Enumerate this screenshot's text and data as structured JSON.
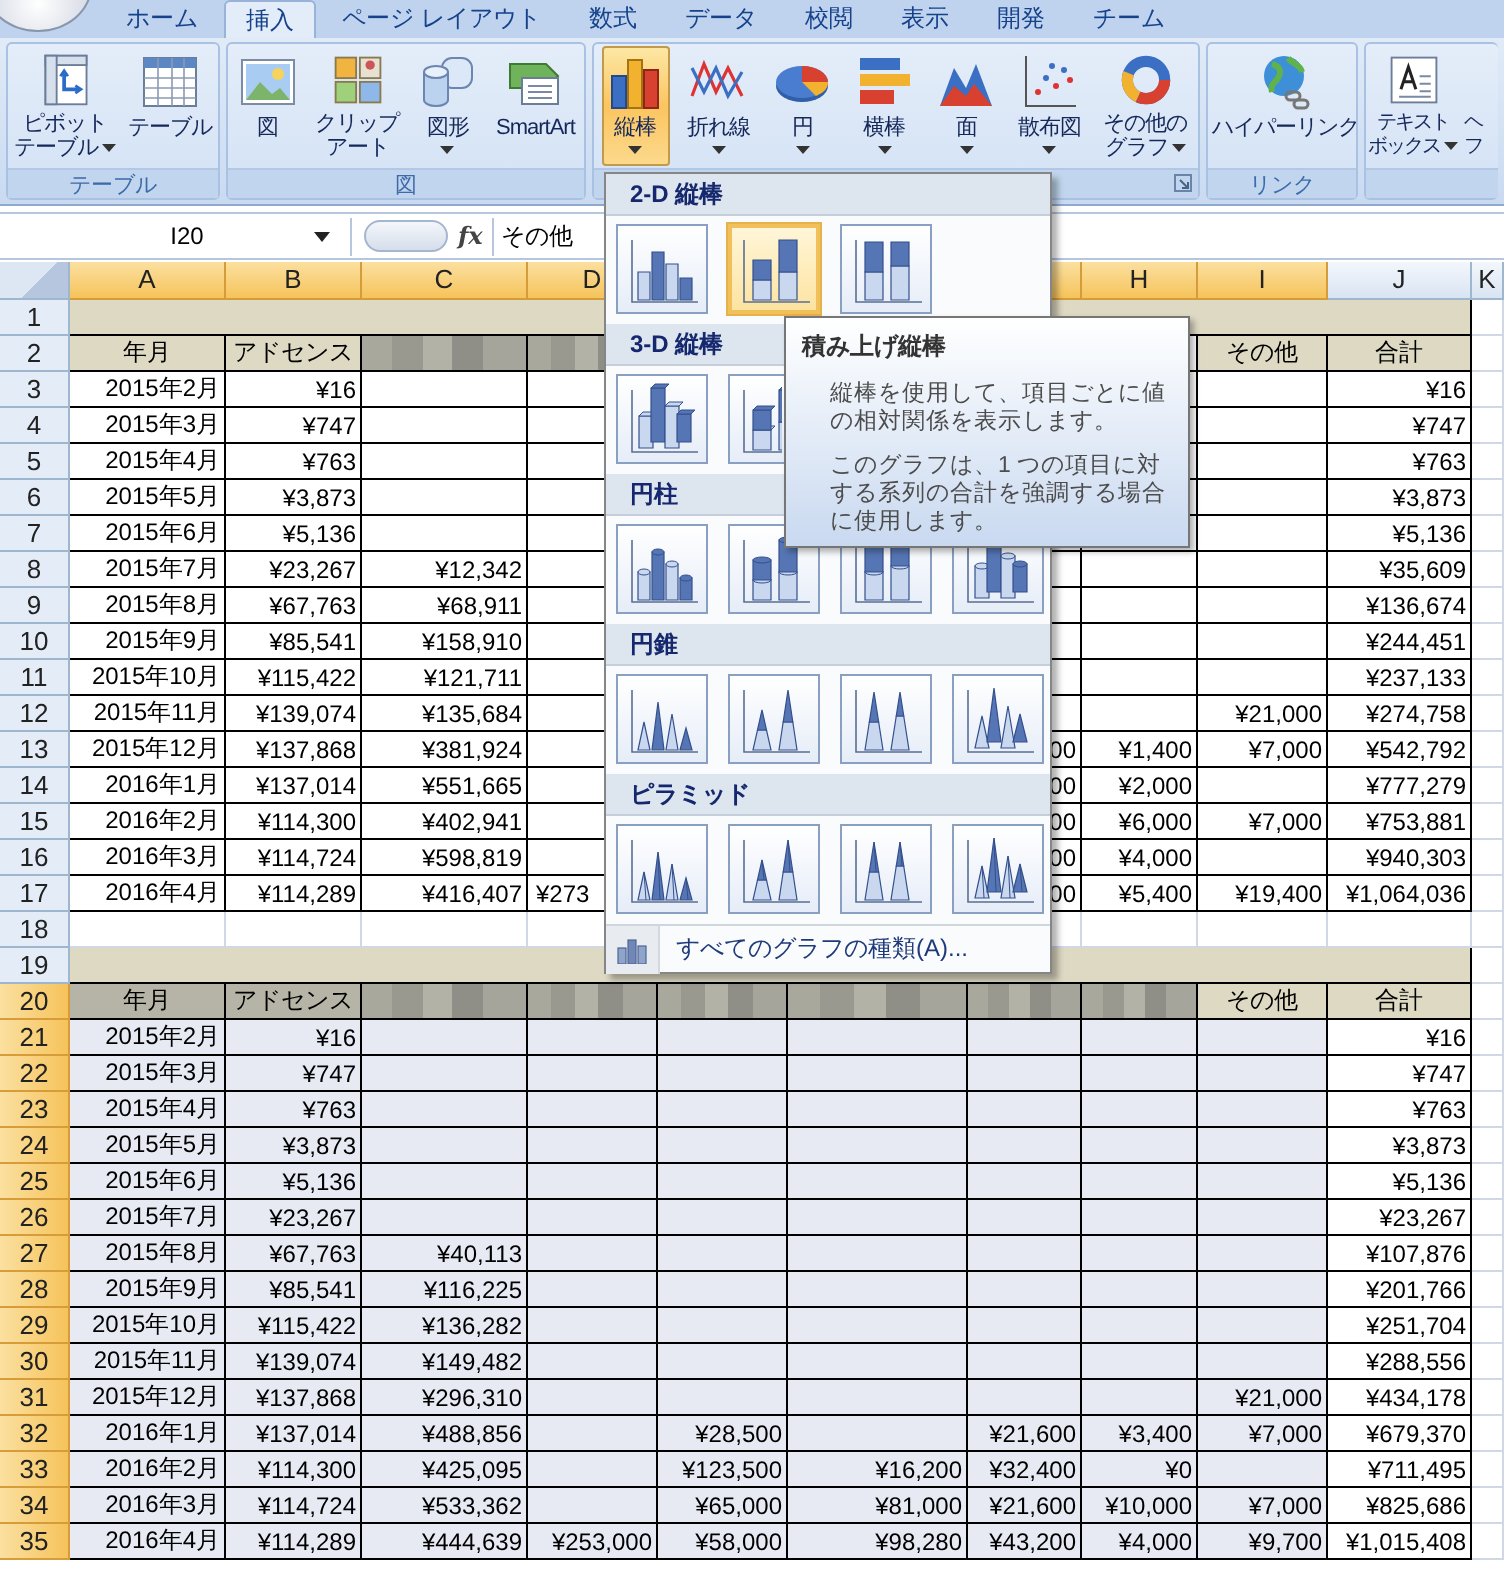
{
  "tabs": [
    {
      "label": "ホーム",
      "selected": false
    },
    {
      "label": "挿入",
      "selected": true
    },
    {
      "label": "ページ レイアウト",
      "selected": false
    },
    {
      "label": "数式",
      "selected": false
    },
    {
      "label": "データ",
      "selected": false
    },
    {
      "label": "校閲",
      "selected": false
    },
    {
      "label": "表示",
      "selected": false
    },
    {
      "label": "開発",
      "selected": false
    },
    {
      "label": "チーム",
      "selected": false
    }
  ],
  "ribbon": {
    "groups": [
      {
        "label": "テーブル",
        "launcher": false,
        "buttons": [
          {
            "lines": [
              "ピボット",
              "テーブル"
            ],
            "dropdown": true,
            "selected": false
          },
          {
            "lines": [
              "テーブル"
            ],
            "dropdown": false,
            "selected": false
          }
        ]
      },
      {
        "label": "図",
        "launcher": false,
        "buttons": [
          {
            "lines": [
              "図"
            ],
            "dropdown": false,
            "selected": false
          },
          {
            "lines": [
              "クリップ",
              "アート"
            ],
            "dropdown": false,
            "selected": false
          },
          {
            "lines": [
              "図形"
            ],
            "dropdown": true,
            "selected": false
          },
          {
            "lines": [
              "SmartArt"
            ],
            "dropdown": false,
            "selected": false
          }
        ]
      },
      {
        "launcher": true,
        "buttons": [
          {
            "lines": [
              "縦棒"
            ],
            "dropdown": true,
            "selected": true
          },
          {
            "lines": [
              "折れ線"
            ],
            "dropdown": true,
            "selected": false
          },
          {
            "lines": [
              "円"
            ],
            "dropdown": true,
            "selected": false
          },
          {
            "lines": [
              "横棒"
            ],
            "dropdown": true,
            "selected": false
          },
          {
            "lines": [
              "面"
            ],
            "dropdown": true,
            "selected": false
          },
          {
            "lines": [
              "散布図"
            ],
            "dropdown": true,
            "selected": false
          },
          {
            "lines": [
              "その他の",
              "グラフ"
            ],
            "dropdown": true,
            "selected": false
          }
        ]
      },
      {
        "label": "リンク",
        "launcher": false,
        "buttons": [
          {
            "lines": [
              "ハイパーリンク"
            ],
            "dropdown": false,
            "selected": false
          }
        ]
      },
      {
        "launcher": false,
        "buttons": [
          {
            "lines": [
              "テキスト",
              "ボックス"
            ],
            "dropdown": true,
            "selected": false
          },
          {
            "lines": [
              "ヘ",
              "フ"
            ],
            "dropdown": false,
            "selected": false
          }
        ]
      }
    ]
  },
  "formula_bar": {
    "name_box": "I20",
    "function_label": "fx",
    "value": "その他"
  },
  "grid": {
    "columns": [
      {
        "label": "A",
        "selected": true
      },
      {
        "label": "B",
        "selected": true
      },
      {
        "label": "C",
        "selected": true
      },
      {
        "label": "D",
        "selected": true
      },
      {
        "selected": true
      },
      {
        "selected": true
      },
      {
        "selected": true
      },
      {
        "label": "H",
        "selected": true
      },
      {
        "label": "I",
        "selected": true
      },
      {
        "label": "J",
        "selected": false
      },
      {
        "label": "K",
        "selected": false
      }
    ],
    "rows": [
      {
        "number": "1",
        "selected": false,
        "kind": "band"
      },
      {
        "number": "2",
        "selected": false,
        "kind": "header",
        "cells": {
          "A": "年月",
          "B": "アドセンス",
          "C": {
            "blurred": true
          },
          "D": {
            "blurred": true
          },
          "I": "その他",
          "J": "合計"
        }
      },
      {
        "number": "3",
        "selected": false,
        "kind": "data",
        "cells": {
          "A": "2015年2月",
          "B": "¥16",
          "J": "¥16"
        }
      },
      {
        "number": "4",
        "selected": false,
        "kind": "data",
        "cells": {
          "A": "2015年3月",
          "B": "¥747",
          "J": "¥747"
        }
      },
      {
        "number": "5",
        "selected": false,
        "kind": "data",
        "cells": {
          "A": "2015年4月",
          "B": "¥763",
          "J": "¥763"
        }
      },
      {
        "number": "6",
        "selected": false,
        "kind": "data",
        "cells": {
          "A": "2015年5月",
          "B": "¥3,873",
          "J": "¥3,873"
        }
      },
      {
        "number": "7",
        "selected": false,
        "kind": "data",
        "cells": {
          "A": "2015年6月",
          "B": "¥5,136",
          "J": "¥5,136"
        }
      },
      {
        "number": "8",
        "selected": false,
        "kind": "data",
        "cells": {
          "A": "2015年7月",
          "B": "¥23,267",
          "C": "¥12,342",
          "J": "¥35,609"
        }
      },
      {
        "number": "9",
        "selected": false,
        "kind": "data",
        "cells": {
          "A": "2015年8月",
          "B": "¥67,763",
          "C": "¥68,911",
          "J": "¥136,674"
        }
      },
      {
        "number": "10",
        "selected": false,
        "kind": "data",
        "cells": {
          "A": "2015年9月",
          "B": "¥85,541",
          "C": "¥158,910",
          "J": "¥244,451"
        }
      },
      {
        "number": "11",
        "selected": false,
        "kind": "data",
        "cells": {
          "A": "2015年10月",
          "B": "¥115,422",
          "C": "¥121,711",
          "J": "¥237,133"
        }
      },
      {
        "number": "12",
        "selected": false,
        "kind": "data",
        "cells": {
          "A": "2015年11月",
          "B": "¥139,074",
          "C": "¥135,684",
          "I": "¥21,000",
          "J": "¥274,758"
        }
      },
      {
        "number": "13",
        "selected": false,
        "kind": "data",
        "cells": {
          "A": "2015年12月",
          "B": "¥137,868",
          "C": "¥381,924",
          "G": "00",
          "H": "¥1,400",
          "I": "¥7,000",
          "J": "¥542,792"
        }
      },
      {
        "number": "14",
        "selected": false,
        "kind": "data",
        "cells": {
          "A": "2016年1月",
          "B": "¥137,014",
          "C": "¥551,665",
          "G": "00",
          "H": "¥2,000",
          "J": "¥777,279"
        }
      },
      {
        "number": "15",
        "selected": false,
        "kind": "data",
        "cells": {
          "A": "2016年2月",
          "B": "¥114,300",
          "C": "¥402,941",
          "G": "00",
          "H": "¥6,000",
          "I": "¥7,000",
          "J": "¥753,881"
        }
      },
      {
        "number": "16",
        "selected": false,
        "kind": "data",
        "cells": {
          "A": "2016年3月",
          "B": "¥114,724",
          "C": "¥598,819",
          "G": "00",
          "H": "¥4,000",
          "J": "¥940,303"
        }
      },
      {
        "number": "17",
        "selected": false,
        "kind": "data",
        "cells": {
          "A": "2016年4月",
          "B": "¥114,289",
          "C": "¥416,407",
          "D": {
            "text": "¥273",
            "cut": true
          },
          "G": "00",
          "H": "¥5,400",
          "I": "¥19,400",
          "J": "¥1,064,036"
        }
      },
      {
        "number": "18",
        "selected": false,
        "kind": "blank"
      },
      {
        "number": "19",
        "selected": false,
        "kind": "band"
      },
      {
        "number": "20",
        "selected": true,
        "kind": "header",
        "cells": {
          "A": "年月",
          "B": "アドセンス",
          "C": {
            "blurred": true
          },
          "D": {
            "blurred": true
          },
          "E": {
            "blurred": true
          },
          "F": {
            "blurred": true
          },
          "G": {
            "blurred": true
          },
          "H": {
            "blurred": true
          },
          "I": {
            "text": "その他",
            "active": true
          },
          "J": "合計"
        }
      },
      {
        "number": "21",
        "selected": true,
        "kind": "data",
        "cells": {
          "A": "2015年2月",
          "B": "¥16",
          "J": "¥16"
        }
      },
      {
        "number": "22",
        "selected": true,
        "kind": "data",
        "cells": {
          "A": "2015年3月",
          "B": "¥747",
          "J": "¥747"
        }
      },
      {
        "number": "23",
        "selected": true,
        "kind": "data",
        "cells": {
          "A": "2015年4月",
          "B": "¥763",
          "J": "¥763"
        }
      },
      {
        "number": "24",
        "selected": true,
        "kind": "data",
        "cells": {
          "A": "2015年5月",
          "B": "¥3,873",
          "J": "¥3,873"
        }
      },
      {
        "number": "25",
        "selected": true,
        "kind": "data",
        "cells": {
          "A": "2015年6月",
          "B": "¥5,136",
          "J": "¥5,136"
        }
      },
      {
        "number": "26",
        "selected": true,
        "kind": "data",
        "cells": {
          "A": "2015年7月",
          "B": "¥23,267",
          "J": "¥23,267"
        }
      },
      {
        "number": "27",
        "selected": true,
        "kind": "data",
        "cells": {
          "A": "2015年8月",
          "B": "¥67,763",
          "C": "¥40,113",
          "J": "¥107,876"
        }
      },
      {
        "number": "28",
        "selected": true,
        "kind": "data",
        "cells": {
          "A": "2015年9月",
          "B": "¥85,541",
          "C": "¥116,225",
          "J": "¥201,766"
        }
      },
      {
        "number": "29",
        "selected": true,
        "kind": "data",
        "cells": {
          "A": "2015年10月",
          "B": "¥115,422",
          "C": "¥136,282",
          "J": "¥251,704"
        }
      },
      {
        "number": "30",
        "selected": true,
        "kind": "data",
        "cells": {
          "A": "2015年11月",
          "B": "¥139,074",
          "C": "¥149,482",
          "J": "¥288,556"
        }
      },
      {
        "number": "31",
        "selected": true,
        "kind": "data",
        "cells": {
          "A": "2015年12月",
          "B": "¥137,868",
          "C": "¥296,310",
          "I": "¥21,000",
          "J": "¥434,178"
        }
      },
      {
        "number": "32",
        "selected": true,
        "kind": "data",
        "cells": {
          "A": "2016年1月",
          "B": "¥137,014",
          "C": "¥488,856",
          "E": "¥28,500",
          "G": "¥21,600",
          "H": "¥3,400",
          "I": "¥7,000",
          "J": "¥679,370"
        }
      },
      {
        "number": "33",
        "selected": true,
        "kind": "data",
        "cells": {
          "A": "2016年2月",
          "B": "¥114,300",
          "C": "¥425,095",
          "E": "¥123,500",
          "F": "¥16,200",
          "G": "¥32,400",
          "H": "¥0",
          "J": "¥711,495"
        }
      },
      {
        "number": "34",
        "selected": true,
        "kind": "data",
        "cells": {
          "A": "2016年3月",
          "B": "¥114,724",
          "C": "¥533,362",
          "E": "¥65,000",
          "F": "¥81,000",
          "G": "¥21,600",
          "H": "¥10,000",
          "I": "¥7,000",
          "J": "¥825,686"
        }
      },
      {
        "number": "35",
        "selected": true,
        "kind": "data",
        "cells": {
          "A": "2016年4月",
          "B": "¥114,289",
          "C": "¥444,639",
          "D": "¥253,000",
          "E": "¥58,000",
          "F": "¥98,280",
          "G": "¥43,200",
          "H": "¥4,000",
          "I": "¥9,700",
          "J": "¥1,015,408"
        }
      }
    ]
  },
  "chart_menu": {
    "sections": [
      {
        "title": "2-D 縦棒",
        "kind": "bar",
        "items": [
          {
            "kind": "clustered",
            "selected": false
          },
          {
            "kind": "stacked",
            "selected": true
          },
          {
            "kind": "percent",
            "selected": false
          }
        ]
      },
      {
        "title": "3-D 縦棒",
        "kind": "box",
        "items": [
          {
            "kind": "depth",
            "selected": false
          },
          {
            "kind": "stacked",
            "selected": false
          }
        ]
      },
      {
        "title": "円柱",
        "kind": "cylinder",
        "items": [
          {
            "kind": "clustered",
            "selected": false
          },
          {
            "kind": "stacked",
            "selected": false
          },
          {
            "kind": "percent",
            "selected": false
          },
          {
            "kind": "depth",
            "selected": false
          }
        ]
      },
      {
        "title": "円錐",
        "kind": "cone",
        "items": [
          {
            "kind": "clustered",
            "selected": false
          },
          {
            "kind": "stacked",
            "selected": false
          },
          {
            "kind": "percent",
            "selected": false
          },
          {
            "kind": "depth",
            "selected": false
          }
        ]
      },
      {
        "title": "ピラミッド",
        "kind": "pyramid",
        "items": [
          {
            "kind": "clustered",
            "selected": false
          },
          {
            "kind": "stacked",
            "selected": false
          },
          {
            "kind": "percent",
            "selected": false
          },
          {
            "kind": "depth",
            "selected": false
          }
        ]
      }
    ],
    "footer": "すべてのグラフの種類(A)..."
  },
  "tooltip": {
    "title": "積み上げ縦棒",
    "paragraphs": [
      "縦棒を使用して、項目ごとに値の相対関係を表示します。",
      "このグラフは、1 つの項目に対する系列の合計を強調する場合に使用します。"
    ]
  }
}
